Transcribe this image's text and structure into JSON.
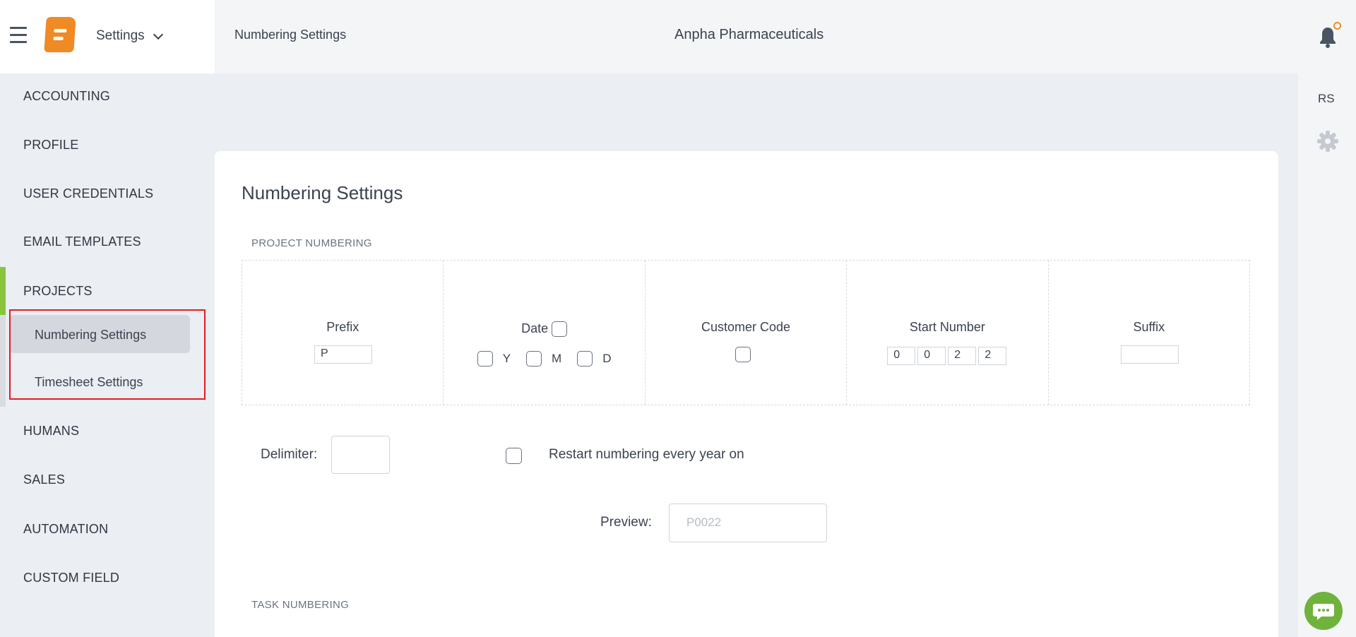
{
  "header": {
    "module_label": "Settings",
    "breadcrumb": "Numbering Settings",
    "company": "Anpha Pharmaceuticals"
  },
  "right_rail": {
    "initials": "RS"
  },
  "sidebar": {
    "items": [
      {
        "label": "ACCOUNTING"
      },
      {
        "label": "PROFILE"
      },
      {
        "label": "USER CREDENTIALS"
      },
      {
        "label": "EMAIL TEMPLATES"
      },
      {
        "label": "PROJECTS"
      },
      {
        "label": "HUMANS"
      },
      {
        "label": "SALES"
      },
      {
        "label": "AUTOMATION"
      },
      {
        "label": "CUSTOM FIELD"
      }
    ],
    "sub_items": [
      {
        "label": "Numbering Settings",
        "active": true
      },
      {
        "label": "Timesheet Settings",
        "active": false
      }
    ]
  },
  "main": {
    "title": "Numbering Settings",
    "project_section": "PROJECT NUMBERING",
    "task_section": "TASK NUMBERING",
    "columns": {
      "prefix": {
        "label": "Prefix",
        "value": "P"
      },
      "date": {
        "label": "Date",
        "parts": [
          "Y",
          "M",
          "D"
        ]
      },
      "customer_code": {
        "label": "Customer Code"
      },
      "start_number": {
        "label": "Start Number",
        "digits": [
          "0",
          "0",
          "2",
          "2"
        ]
      },
      "suffix": {
        "label": "Suffix",
        "value": ""
      }
    },
    "delimiter": {
      "label": "Delimiter:",
      "value": ""
    },
    "restart": {
      "label": "Restart numbering every year on",
      "checked": false
    },
    "preview": {
      "label": "Preview:",
      "value": "P0022"
    }
  },
  "colors": {
    "accent": "#f08a24",
    "active_indicator": "#8ac43f",
    "highlight_box": "#e31b23",
    "chat": "#6fb23c"
  },
  "icons": [
    "hamburger-icon",
    "app-logo",
    "chevron-down-icon",
    "bell-icon",
    "gear-icon",
    "chat-icon"
  ]
}
